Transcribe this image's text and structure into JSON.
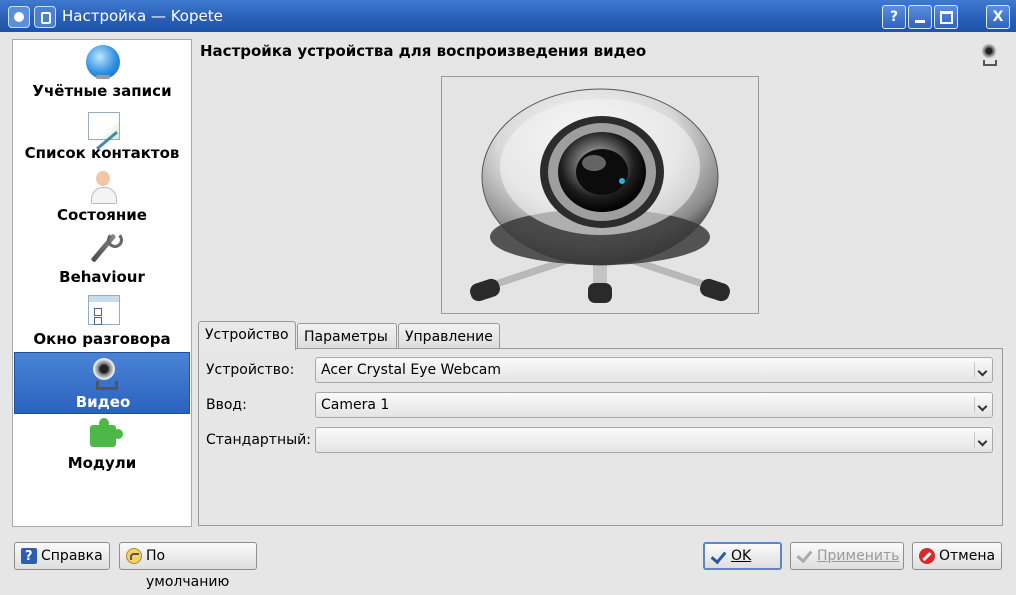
{
  "window": {
    "title": "Настройка — Kopete",
    "help_glyph": "?",
    "close_glyph": "X"
  },
  "sidebar": {
    "items": [
      {
        "label": "Учётные записи",
        "icon": "globe-icon"
      },
      {
        "label": "Список контактов",
        "icon": "contact-list-icon"
      },
      {
        "label": "Состояние",
        "icon": "person-icon"
      },
      {
        "label": "Behaviour",
        "icon": "wrench-icon"
      },
      {
        "label": "Окно разговора",
        "icon": "chat-window-icon"
      },
      {
        "label": "Видео",
        "icon": "webcam-icon",
        "selected": true
      },
      {
        "label": "Модули",
        "icon": "puzzle-icon"
      }
    ]
  },
  "main": {
    "title": "Настройка устройства для воспроизведения видео",
    "tabs": [
      {
        "label": "Устройство",
        "active": true
      },
      {
        "label": "Параметры"
      },
      {
        "label": "Управление"
      }
    ],
    "fields": [
      {
        "label": "Устройство:",
        "value": "Acer Crystal Eye Webcam"
      },
      {
        "label": "Ввод:",
        "value": "Camera 1"
      },
      {
        "label": "Стандартный:",
        "value": ""
      }
    ]
  },
  "buttons": {
    "help": "Справка",
    "defaults": "По умолчанию",
    "ok": "OK",
    "apply": "Применить",
    "cancel": "Отмена"
  },
  "colors": {
    "titlebar": "#2a60b8",
    "selection": "#3a72c9",
    "window_bg": "#e6e6e6"
  }
}
